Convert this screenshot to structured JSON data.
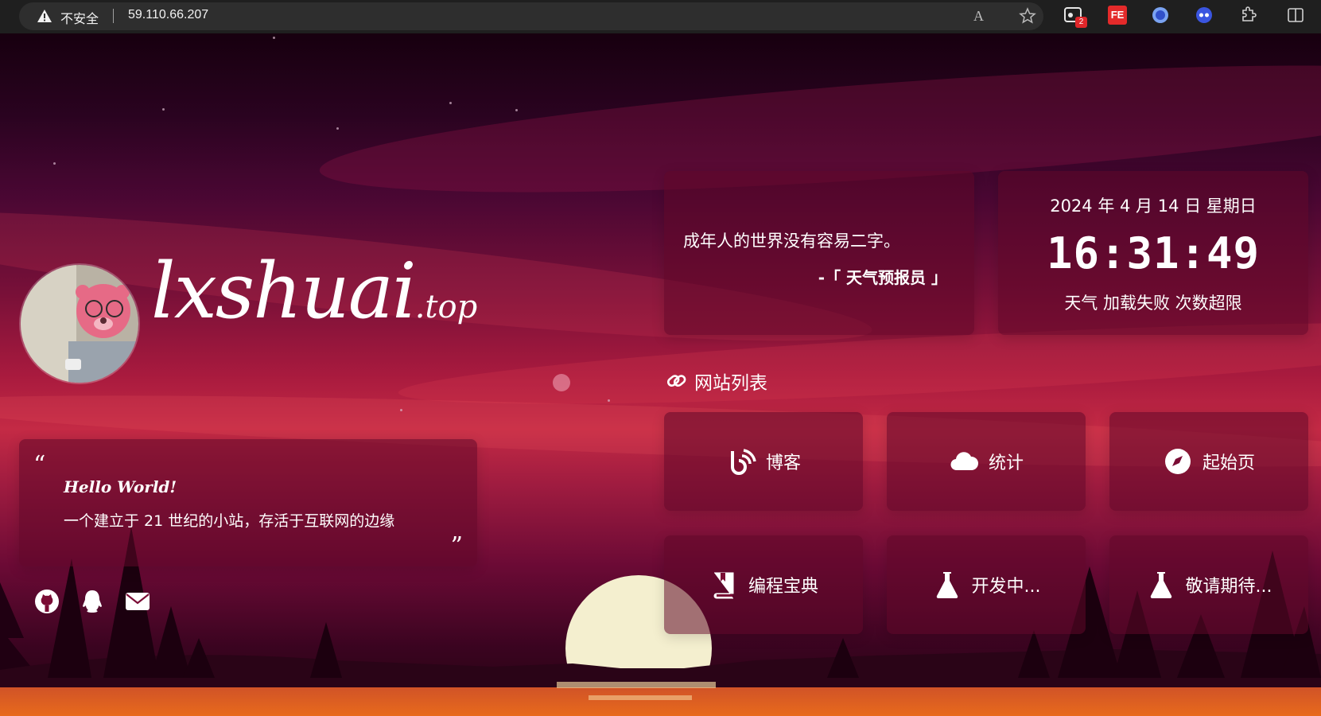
{
  "browser": {
    "security_label": "不安全",
    "url": "59.110.66.207",
    "read_aloud_glyph": "A",
    "ext_badge_count": "2",
    "ext_fe_label": "FE"
  },
  "site": {
    "title_main": "lxshuai",
    "title_tld": ".top",
    "avatar_icon": "avatar-bear-photo"
  },
  "intro": {
    "open_quote": "“",
    "greeting": "Hello World!",
    "text": "一个建立于 21 世纪的小站，存活于互联网的边缘",
    "close_quote": "”"
  },
  "social": [
    {
      "name": "github-icon"
    },
    {
      "name": "qq-icon"
    },
    {
      "name": "email-icon"
    }
  ],
  "motto": {
    "text": "成年人的世界没有容易二字。",
    "source": "-「 天气预报员 」"
  },
  "clock": {
    "date": "2024 年 4 月 14 日 星期日",
    "time": "16:31:49",
    "weather": "天气 加载失败 次数超限"
  },
  "links": {
    "title": "网站列表",
    "items": [
      {
        "label": "博客",
        "icon": "blog-icon"
      },
      {
        "label": "统计",
        "icon": "cloud-icon"
      },
      {
        "label": "起始页",
        "icon": "compass-icon"
      },
      {
        "label": "编程宝典",
        "icon": "book-icon"
      },
      {
        "label": "开发中...",
        "icon": "flask-icon"
      },
      {
        "label": "敬请期待...",
        "icon": "flask-icon"
      }
    ]
  },
  "colors": {
    "card_bg": "rgba(95,8,40,0.55)",
    "sun": "#f4efcf",
    "sky_top": "#17000f",
    "sky_glow": "#c42a45"
  }
}
